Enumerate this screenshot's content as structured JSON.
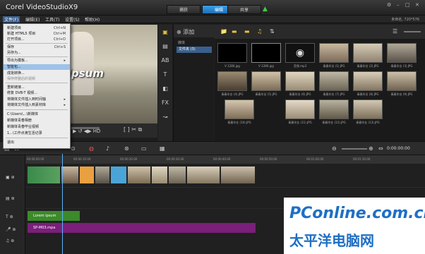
{
  "app": {
    "title": "Corel VideoStudioX9"
  },
  "steps": [
    {
      "label": "捕获"
    },
    {
      "label": "编辑"
    },
    {
      "label": "共享"
    }
  ],
  "menubar": {
    "items": [
      "文件(F)",
      "编辑(E)",
      "工具(T)",
      "设置(S)",
      "帮助(H)"
    ]
  },
  "resolution": "未命名, 720*576",
  "file_menu": {
    "items": [
      {
        "label": "新建项目",
        "shortcut": "Ctrl+N"
      },
      {
        "label": "新建 HTML5 项目",
        "shortcut": "Ctrl+M"
      },
      {
        "label": "打开项目...",
        "shortcut": "Ctrl+O"
      },
      {
        "label": "保存",
        "shortcut": "Ctrl+S"
      },
      {
        "label": "另存为...",
        "shortcut": ""
      },
      {
        "label": "导出为模板...",
        "shortcut": ""
      },
      {
        "label": "智能包...",
        "shortcut": ""
      },
      {
        "label": "成批转换...",
        "shortcut": ""
      },
      {
        "label": "保存修整后的视频",
        "shortcut": ""
      },
      {
        "label": "重新链接...",
        "shortcut": ""
      },
      {
        "label": "修复 DVB-T 视频...",
        "shortcut": ""
      },
      {
        "label": "将媒体文件插入到时间轴",
        "shortcut": ""
      },
      {
        "label": "将媒体文件插入到素材库",
        "shortcut": ""
      },
      {
        "label": "C:\\Users\\...\\新媒体",
        "shortcut": ""
      },
      {
        "label": "新媒体青春相册",
        "shortcut": ""
      },
      {
        "label": "新媒体青春毕业视频",
        "shortcut": ""
      },
      {
        "label": "1...\\工作点滴生活记录",
        "shortcut": ""
      },
      {
        "label": "退出",
        "shortcut": ""
      }
    ]
  },
  "preview": {
    "overlay_text": "m ipsum",
    "timecode": "00:00:00:00"
  },
  "library": {
    "section_label": "媒体",
    "folder": "文件夹 (3)",
    "thumbnails": [
      {
        "caption": "V 1280.jpg"
      },
      {
        "caption": "V 1280.jpg"
      },
      {
        "caption": "音频.mp3"
      },
      {
        "caption": "青春毕业 (1).JPG"
      },
      {
        "caption": "青春毕业 (2).JPG"
      },
      {
        "caption": "青春毕业 (3).JPG"
      },
      {
        "caption": "青春毕业 (4).JPG"
      },
      {
        "caption": "青春毕业 (5).JPG"
      },
      {
        "caption": "青春毕业 (6).JPG"
      },
      {
        "caption": "青春毕业 (7).JPG"
      },
      {
        "caption": "青春毕业 (8).JPG"
      },
      {
        "caption": "青春毕业 (9).JPG"
      },
      {
        "caption": "青春毕业 (10).JPG"
      },
      {
        "caption": "青春毕业 (11).JPG"
      },
      {
        "caption": "青春毕业 (12).JPG"
      },
      {
        "caption": "青春毕业 (13).JPG"
      }
    ]
  },
  "timeline": {
    "timecode": "0:00:00:00",
    "ruler": [
      "00:00:00:00",
      "00:00:10:00",
      "00:00:20:00",
      "00:00:30:00",
      "00:00:40:00",
      "00:00:50:00",
      "00:01:00:00",
      "00:01:10:00"
    ],
    "title_clip": "Lorem ipsum",
    "music_clip": "SP-M03.mpa"
  },
  "watermark": {
    "brand": "PConline.com.cn",
    "cn": "太平洋电脑网"
  }
}
